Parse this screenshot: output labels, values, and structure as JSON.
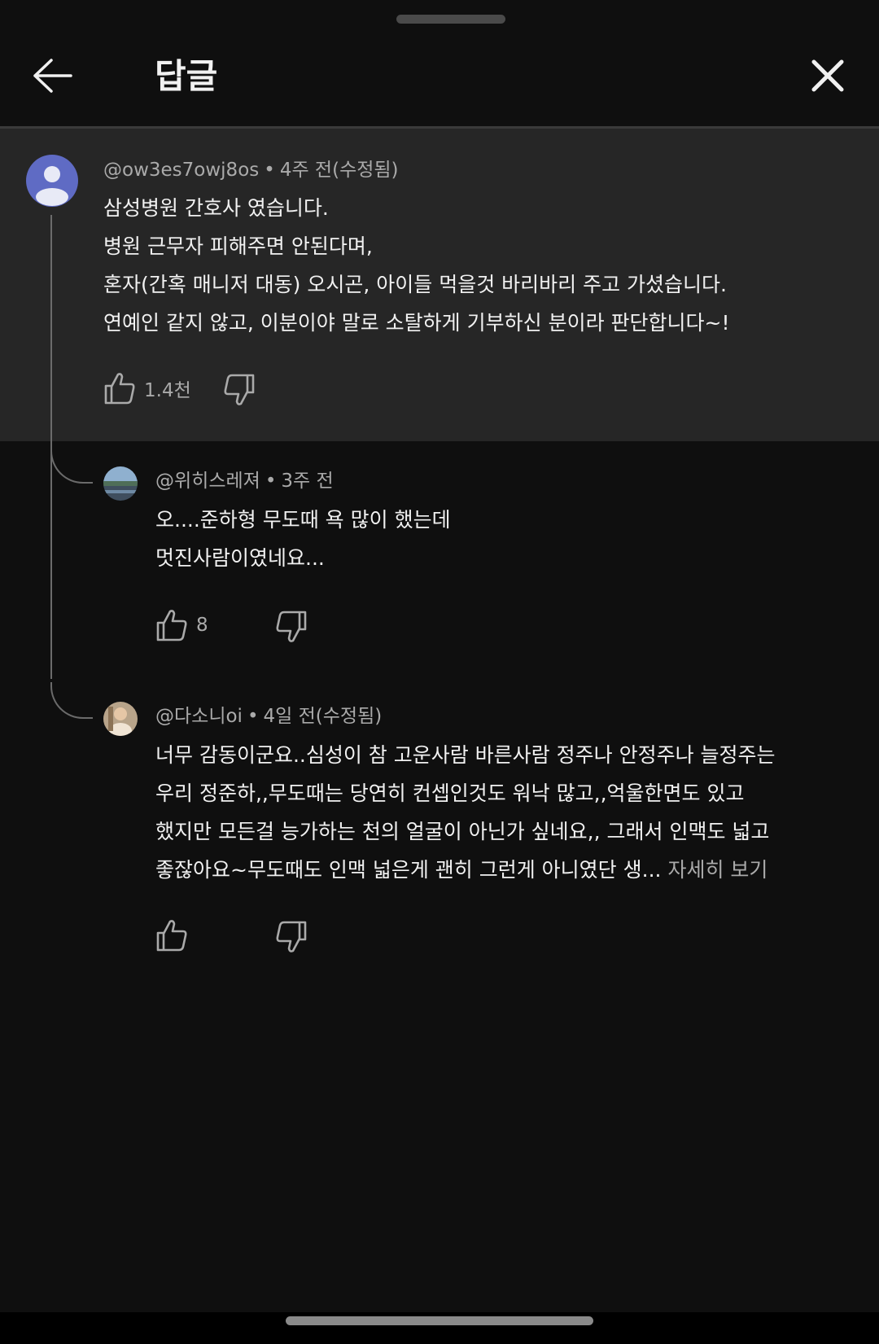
{
  "header": {
    "title": "답글",
    "back_icon": "arrow-left-icon",
    "close_icon": "close-icon"
  },
  "parent_comment": {
    "handle": "@ow3es7owj8os",
    "time": "4주 전(수정됨)",
    "lines": [
      "삼성병원 간호사 였습니다.",
      "병원 근무자 피해주면 안된다며,",
      "혼자(간혹 매니저 대동) 오시곤, 아이들 먹을것 바리바리 주고 가셨습니다.",
      "연예인 같지 않고, 이분이야 말로 소탈하게 기부하신 분이라 판단합니다~!"
    ],
    "likes": "1.4천",
    "avatar_color": "#5f6bc4"
  },
  "replies": [
    {
      "handle": "@위히스레져",
      "time": "3주 전",
      "lines": [
        "오....준하형 무도때 욕 많이 했는데",
        "멋진사람이였네요..."
      ],
      "likes": "8"
    },
    {
      "handle": "@다소니oi",
      "time": "4일 전(수정됨)",
      "lines": [
        "너무 감동이군요..심성이 참 고운사람 바른사람 정주나 안정주나 늘정주는",
        "우리 정준하,,무도때는 당연히 컨셉인것도 워낙 많고,,억울한면도 있고",
        "했지만 모든걸 능가하는 천의 얼굴이 아닌가 싶네요,, 그래서 인맥도 넓고",
        "좋잖아요~무도때도 인맥 넓은게 괜히 그런게 아니였단 생..."
      ],
      "read_more": "자세히 보기",
      "likes": ""
    }
  ],
  "meta_separator": "•",
  "colors": {
    "sheet_background": "#0f0f0f",
    "highlight_background": "#262626",
    "primary_text": "#f1f1f1",
    "secondary_text": "#aaaaaa"
  }
}
